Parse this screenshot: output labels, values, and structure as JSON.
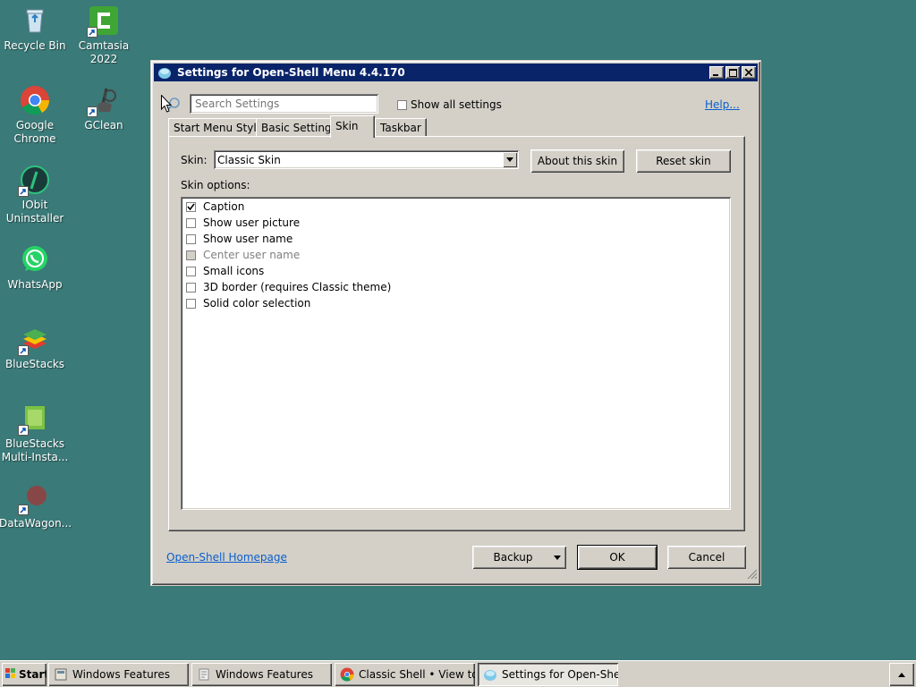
{
  "desktop": {
    "icons": [
      {
        "label": "Recycle Bin",
        "icon": "recycle-bin-icon"
      },
      {
        "label": "Camtasia 2022",
        "icon": "camtasia-icon"
      },
      {
        "label": "Google Chrome",
        "icon": "chrome-icon"
      },
      {
        "label": "GClean",
        "icon": "gclean-icon"
      },
      {
        "label": "IObit Uninstaller",
        "icon": "iobit-icon"
      },
      {
        "label": "WhatsApp",
        "icon": "whatsapp-icon"
      },
      {
        "label": "BlueStacks",
        "icon": "bluestacks-icon"
      },
      {
        "label": "BlueStacks Multi-Insta...",
        "icon": "bluestacks-multi-icon"
      },
      {
        "label": "DataWagon...",
        "icon": "datawagon-icon"
      }
    ]
  },
  "window": {
    "title": "Settings for Open-Shell Menu 4.4.170",
    "search_placeholder": "Search Settings",
    "show_all_label": "Show all settings",
    "help_link": "Help...",
    "tabs": [
      {
        "label": "Start Menu Style",
        "active": false
      },
      {
        "label": "Basic Settings",
        "active": false
      },
      {
        "label": "Skin",
        "active": true
      },
      {
        "label": "Taskbar",
        "active": false
      }
    ],
    "skin": {
      "label": "Skin:",
      "selected": "Classic Skin",
      "about_button": "About this skin",
      "reset_button": "Reset skin",
      "options_label": "Skin options:",
      "options": [
        {
          "label": "Caption",
          "checked": true,
          "disabled": false
        },
        {
          "label": "Show user picture",
          "checked": false,
          "disabled": false
        },
        {
          "label": "Show user name",
          "checked": false,
          "disabled": false
        },
        {
          "label": "Center user name",
          "checked": false,
          "disabled": true
        },
        {
          "label": "Small icons",
          "checked": false,
          "disabled": false
        },
        {
          "label": "3D border (requires Classic theme)",
          "checked": false,
          "disabled": false
        },
        {
          "label": "Solid color selection",
          "checked": false,
          "disabled": false
        }
      ]
    },
    "homepage_link": "Open-Shell Homepage",
    "backup_button": "Backup",
    "ok_button": "OK",
    "cancel_button": "Cancel"
  },
  "taskbar": {
    "start_label": "Start",
    "items": [
      {
        "label": "Windows Features",
        "active": false
      },
      {
        "label": "Windows Features",
        "active": false
      },
      {
        "label": "Classic Shell • View topi...",
        "active": false
      },
      {
        "label": "Settings for Open-Shell ...",
        "active": true
      }
    ]
  }
}
